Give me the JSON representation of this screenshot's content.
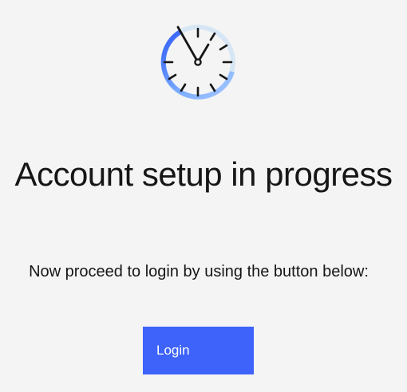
{
  "status": {
    "icon": "clock-progress-icon",
    "title": "Account setup in progress",
    "message": "Now proceed to login by using the button below:"
  },
  "actions": {
    "login_label": "Login"
  },
  "colors": {
    "background": "#f4f4f4",
    "accent": "#3d63fb",
    "progress_light": "#d0e2ff",
    "progress_mid": "#78a9ff",
    "text": "#161616"
  }
}
